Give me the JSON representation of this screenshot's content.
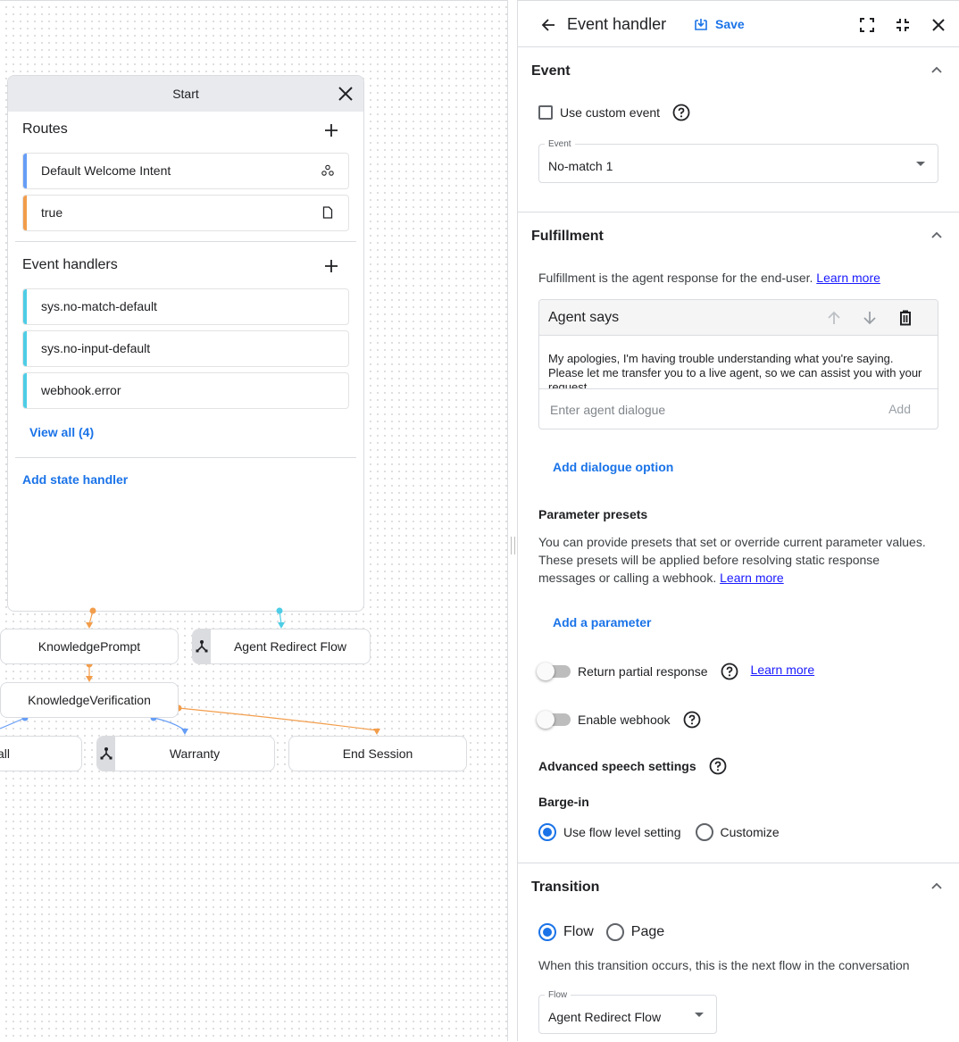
{
  "canvas": {
    "start_panel": {
      "title": "Start",
      "routes_label": "Routes",
      "routes": [
        {
          "label": "Default Welcome Intent",
          "color": "#669df6",
          "icon": "intent-icon"
        },
        {
          "label": "true",
          "color": "#f29d4b",
          "icon": "page-icon"
        }
      ],
      "event_handlers_label": "Event handlers",
      "event_handlers": [
        {
          "label": "sys.no-match-default",
          "color": "#4ecde6"
        },
        {
          "label": "sys.no-input-default",
          "color": "#4ecde6"
        },
        {
          "label": "webhook.error",
          "color": "#4ecde6"
        }
      ],
      "view_all": "View all (4)",
      "add_state_handler": "Add state handler"
    },
    "nodes": [
      {
        "label": "KnowledgePrompt",
        "type": "page"
      },
      {
        "label": "Agent Redirect Flow",
        "type": "flow"
      },
      {
        "label": "KnowledgeVerification",
        "type": "page"
      },
      {
        "label": "all",
        "type": "page"
      },
      {
        "label": "Warranty",
        "type": "flow"
      },
      {
        "label": "End Session",
        "type": "page"
      }
    ],
    "colors": {
      "orange": "#f29d4b",
      "cyan": "#4ecde6",
      "blue": "#669df6"
    }
  },
  "panel": {
    "title": "Event handler",
    "save_label": "Save",
    "event": {
      "title": "Event",
      "custom_event_label": "Use custom event",
      "custom_event_checked": false,
      "select_label": "Event",
      "select_value": "No-match 1"
    },
    "fulfillment": {
      "title": "Fulfillment",
      "description": "Fulfillment is the agent response for the end-user.",
      "learn_more": "Learn more",
      "agent_says_title": "Agent says",
      "agent_says_text": "My apologies, I'm having trouble understanding what you're saying. Please let me transfer you to a live agent, so we can assist you with your request.",
      "dialogue_placeholder": "Enter agent dialogue",
      "add_label": "Add",
      "add_dialogue_option": "Add dialogue option",
      "parameter_presets_title": "Parameter presets",
      "parameter_presets_desc": "You can provide presets that set or override current parameter values. These presets will be applied before resolving static response messages or calling a webhook.",
      "parameter_learn_more": "Learn more",
      "add_parameter": "Add a parameter",
      "return_partial_label": "Return partial response",
      "return_partial_on": false,
      "return_partial_learn_more": "Learn more",
      "enable_webhook_label": "Enable webhook",
      "enable_webhook_on": false,
      "advanced_speech_title": "Advanced speech settings",
      "barge_in_title": "Barge-in",
      "barge_in_options": [
        "Use flow level setting",
        "Customize"
      ],
      "barge_in_selected": "Use flow level setting"
    },
    "transition": {
      "title": "Transition",
      "options": [
        "Flow",
        "Page"
      ],
      "selected": "Flow",
      "description": "When this transition occurs, this is the next flow in the conversation",
      "select_label": "Flow",
      "select_value": "Agent Redirect Flow"
    },
    "accent_color": "#1a73e8"
  }
}
